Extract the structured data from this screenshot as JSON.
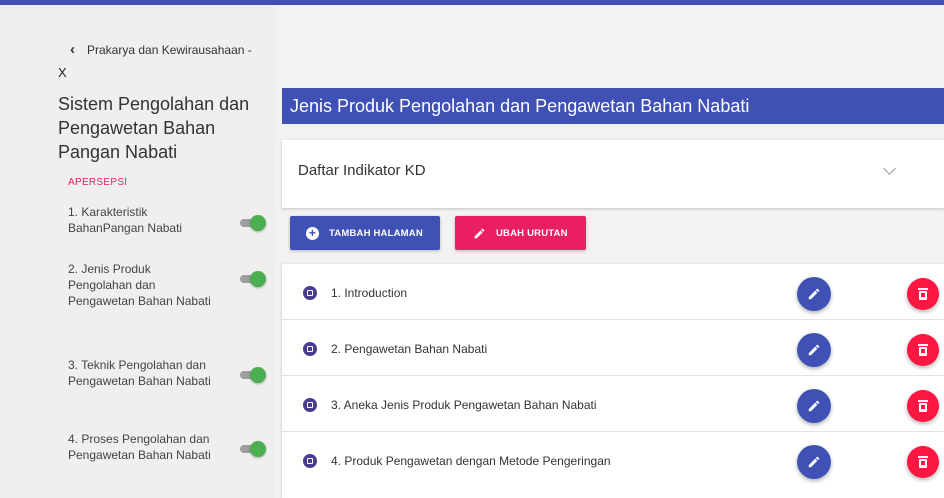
{
  "sidebar": {
    "back_label": "Prakarya dan Kewirausahaan -",
    "close_label": "X",
    "title": "Sistem Pengolahan dan Pengawetan Bahan Pangan Nabati",
    "section_label": "APERSEPSI",
    "items": [
      {
        "label": "1. Karakteristik BahanPangan Nabati",
        "enabled": true
      },
      {
        "label": "2. Jenis Produk Pengolahan dan Pengawetan Bahan Nabati",
        "enabled": true
      },
      {
        "label": "3. Teknik Pengolahan dan Pengawetan Bahan Nabati",
        "enabled": true
      },
      {
        "label": "4. Proses Pengolahan dan Pengawetan Bahan Nabati",
        "enabled": true
      }
    ]
  },
  "main": {
    "header_title": "Jenis Produk Pengolahan dan Pengawetan Bahan Nabati",
    "kd_label": "Daftar Indikator KD",
    "add_button": "TAMBAH HALAMAN",
    "reorder_button": "UBAH URUTAN",
    "pages": [
      {
        "title": "1. Introduction"
      },
      {
        "title": "2. Pengawetan Bahan Nabati"
      },
      {
        "title": "3. Aneka Jenis Produk Pengawetan Bahan Nabati"
      },
      {
        "title": "4. Produk Pengawetan dengan Metode Pengeringan"
      }
    ]
  },
  "colors": {
    "primary": "#3f51b5",
    "accent": "#e91e63",
    "delete": "#ff1744",
    "toggle_on": "#4caf50"
  },
  "icons": {
    "back": "chevron-left-icon",
    "close": "x-icon",
    "expand": "chevron-down-icon",
    "add": "plus-circle-icon",
    "reorder": "pencil-icon",
    "page": "document-icon",
    "edit": "pencil-icon",
    "delete": "trash-icon"
  }
}
